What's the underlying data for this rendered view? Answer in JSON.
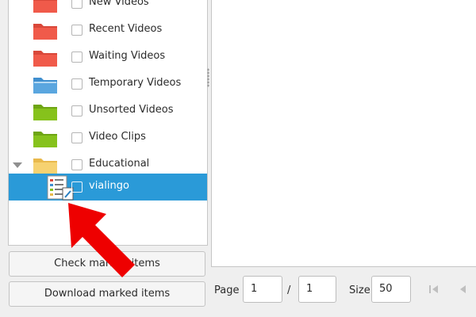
{
  "tree": {
    "items": [
      {
        "label": "New Videos",
        "folder_color": "red"
      },
      {
        "label": "Recent Videos",
        "folder_color": "red"
      },
      {
        "label": "Waiting Videos",
        "folder_color": "red"
      },
      {
        "label": "Temporary Videos",
        "folder_color": "blue"
      },
      {
        "label": "Unsorted Videos",
        "folder_color": "green"
      },
      {
        "label": "Video Clips",
        "folder_color": "green"
      },
      {
        "label": "Educational",
        "folder_color": "yellow",
        "expanded": true
      },
      {
        "label": "vialingo",
        "selected": true,
        "icon": "document-list-icon"
      }
    ]
  },
  "buttons": {
    "check_marked": "Check marked items",
    "download_marked": "Download marked items"
  },
  "pager": {
    "page_label": "Page",
    "page_value": "1",
    "separator": "/",
    "total_pages": "1",
    "size_label": "Size",
    "size_value": "50"
  },
  "colors": {
    "selection": "#2a9ad8",
    "folder_red": "#f05a4a",
    "folder_blue": "#5aa6df",
    "folder_green": "#86c21c",
    "folder_yellow": "#f6d271",
    "annotation_arrow": "#ee0000"
  }
}
